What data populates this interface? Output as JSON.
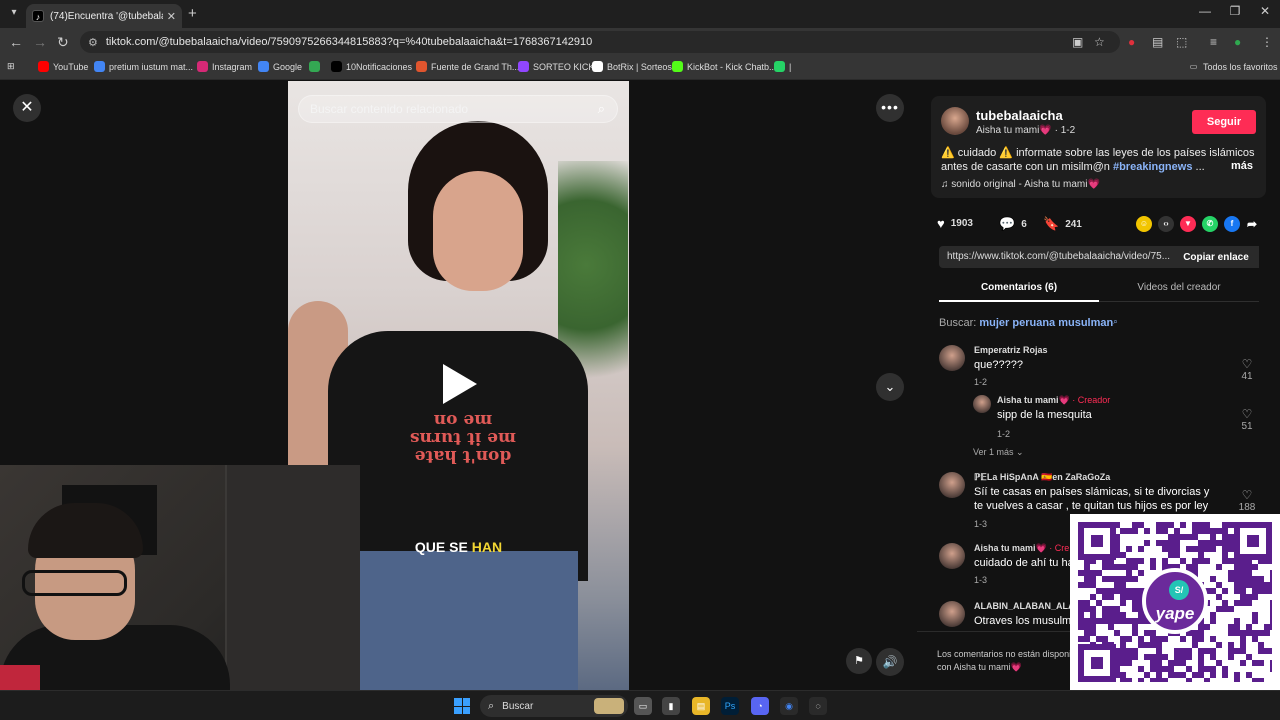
{
  "browser": {
    "tab_title": "(74)Encuentra '@tubebalaaicha",
    "url": "tiktok.com/@tubebalaaicha/video/7590975266344815883?q=%40tubebalaaicha&t=1768367142910",
    "bookmarks": [
      {
        "label": "YouTube",
        "icon": "youtube-icon",
        "color": "#ff0000"
      },
      {
        "label": "pretium iustum mat...",
        "icon": "google-icon",
        "color": "#4285f4"
      },
      {
        "label": "Instagram",
        "icon": "instagram-icon",
        "color": "#d62976"
      },
      {
        "label": "Google",
        "icon": "google-icon",
        "color": "#4285f4"
      },
      {
        "label": "",
        "icon": "colorful-icon",
        "color": "#34a853"
      },
      {
        "label": "10Notificaciones",
        "icon": "x-icon",
        "color": "#000000"
      },
      {
        "label": "Fuente de Grand Th...",
        "icon": "page-icon",
        "color": "#e0552e"
      },
      {
        "label": "SORTEO KICK",
        "icon": "kick-icon",
        "color": "#9146ff"
      },
      {
        "label": "BotRix | Sorteos",
        "icon": "botrix-icon",
        "color": "#ffffff"
      },
      {
        "label": "KickBot - Kick Chatb...",
        "icon": "kickbot-icon",
        "color": "#53fc18"
      },
      {
        "label": "|",
        "icon": "whatsapp-icon",
        "color": "#25d366"
      }
    ],
    "all_bookmarks": "Todos los favoritos"
  },
  "video": {
    "search_placeholder": "Buscar contenido relacionado",
    "caption_prefix": "QUE SE ",
    "caption_highlight": "HAN",
    "shirt_text": "don't hate me it turns me on"
  },
  "post": {
    "username": "tubebalaaicha",
    "display_name": "Aisha tu mami💗",
    "date": "1-2",
    "follow_label": "Seguir",
    "description": "⚠️ cuidado ⚠️ informate sobre las leyes de los países islámicos antes de casarte con un misilm@n ",
    "hashtag": "#breakingnews",
    "ellipsis": "...",
    "more_label": "más",
    "sound": "sonido original - Aisha tu mami💗",
    "likes": "1903",
    "comments_count": "6",
    "saves": "241",
    "link": "https://www.tiktok.com/@tubebalaaicha/video/75...",
    "copy_label": "Copiar enlace",
    "tab_comments": "Comentarios (6)",
    "tab_videos": "Videos del creador",
    "search_prefix": "Buscar: ",
    "search_term": "mujer peruana musulman"
  },
  "comments": [
    {
      "name": "Emperatriz Rojas",
      "text": "que?????",
      "date": "1-2",
      "likes": "41"
    },
    {
      "name": "Aisha tu mami💗",
      "creator": " · Creador",
      "text": "sipp de la mesquita",
      "date": "1-2",
      "likes": "51"
    },
    {
      "name": "ℙ𝔼La HiSpAnA 🇪🇸en ZaRaGoZa",
      "text": "Síí te casas en países slámicas, si te divorcias y te vuelves a casar , te quitan tus hijos es por ley",
      "date": "1-3",
      "likes": "188"
    },
    {
      "name": "Aisha tu mami💗",
      "creator": " · Cre",
      "text": "cuidado de ahí tu ha",
      "date": "1-3",
      "likes": ""
    },
    {
      "name": "ALABIN_ALABAN_ALA",
      "text": "Otraves los musulm",
      "date": "",
      "likes": ""
    }
  ],
  "view_more": "Ver 1 más",
  "comments_footer": "Los comentarios no están disponibles. con Aisha tu mami💗",
  "taskbar": {
    "search_label": "Buscar"
  },
  "qr": {
    "brand": "yape",
    "badge": "S/"
  }
}
